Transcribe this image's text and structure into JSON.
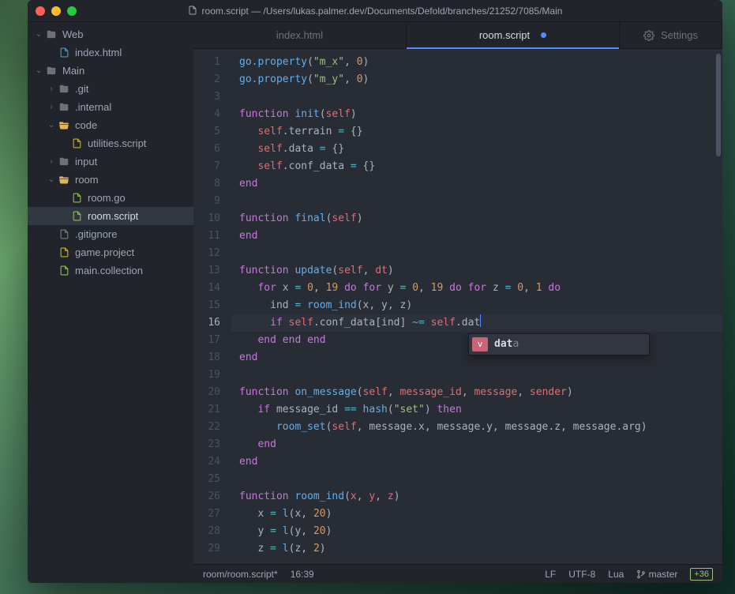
{
  "title": "room.script — /Users/lukas.palmer.dev/Documents/Defold/branches/21252/7085/Main",
  "sidebar": {
    "roots": [
      {
        "label": "Web",
        "expanded": true
      },
      {
        "label": "Main",
        "expanded": true
      }
    ],
    "web_children": [
      {
        "label": "index.html",
        "icon": "file-blue"
      }
    ],
    "main_children": [
      {
        "label": ".git",
        "icon": "folder-closed",
        "chev": "›"
      },
      {
        "label": ".internal",
        "icon": "folder-closed",
        "chev": "›"
      },
      {
        "label": "code",
        "icon": "folder-open",
        "chev": "⌄"
      },
      {
        "label": "utilities.script",
        "icon": "file-yellow",
        "indent": 1
      },
      {
        "label": "input",
        "icon": "folder-closed",
        "chev": "›"
      },
      {
        "label": "room",
        "icon": "folder-open",
        "chev": "⌄"
      },
      {
        "label": "room.go",
        "icon": "file-green",
        "indent": 1
      },
      {
        "label": "room.script",
        "icon": "file-green",
        "indent": 1,
        "active": true
      },
      {
        "label": ".gitignore",
        "icon": "file-grey"
      },
      {
        "label": "game.project",
        "icon": "file-yellow"
      },
      {
        "label": "main.collection",
        "icon": "file-green"
      }
    ]
  },
  "tabs": [
    {
      "label": "index.html",
      "active": false,
      "modified": false
    },
    {
      "label": "room.script",
      "active": true,
      "modified": true
    }
  ],
  "settings_label": "Settings",
  "code": {
    "lines": [
      [
        [
          "fn",
          "go.property"
        ],
        [
          "",
          "("
        ],
        [
          "str",
          "\"m_x\""
        ],
        [
          "",
          ", "
        ],
        [
          "num",
          "0"
        ],
        [
          "",
          ")"
        ]
      ],
      [
        [
          "fn",
          "go.property"
        ],
        [
          "",
          "("
        ],
        [
          "str",
          "\"m_y\""
        ],
        [
          "",
          ", "
        ],
        [
          "num",
          "0"
        ],
        [
          "",
          ")"
        ]
      ],
      [],
      [
        [
          "kw",
          "function"
        ],
        [
          "",
          " "
        ],
        [
          "fn",
          "init"
        ],
        [
          "",
          "("
        ],
        [
          "var",
          "self"
        ],
        [
          "",
          ")"
        ]
      ],
      [
        [
          "",
          "   "
        ],
        [
          "var",
          "self"
        ],
        [
          "",
          ".terrain "
        ],
        [
          "op",
          "="
        ],
        [
          "",
          " {}"
        ]
      ],
      [
        [
          "",
          "   "
        ],
        [
          "var",
          "self"
        ],
        [
          "",
          ".data "
        ],
        [
          "op",
          "="
        ],
        [
          "",
          " {}"
        ]
      ],
      [
        [
          "",
          "   "
        ],
        [
          "var",
          "self"
        ],
        [
          "",
          ".conf_data "
        ],
        [
          "op",
          "="
        ],
        [
          "",
          " {}"
        ]
      ],
      [
        [
          "kw",
          "end"
        ]
      ],
      [],
      [
        [
          "kw",
          "function"
        ],
        [
          "",
          " "
        ],
        [
          "fn",
          "final"
        ],
        [
          "",
          "("
        ],
        [
          "var",
          "self"
        ],
        [
          "",
          ")"
        ]
      ],
      [
        [
          "kw",
          "end"
        ]
      ],
      [],
      [
        [
          "kw",
          "function"
        ],
        [
          "",
          " "
        ],
        [
          "fn",
          "update"
        ],
        [
          "",
          "("
        ],
        [
          "var",
          "self"
        ],
        [
          "",
          ", "
        ],
        [
          "var",
          "dt"
        ],
        [
          "",
          ")"
        ]
      ],
      [
        [
          "",
          "   "
        ],
        [
          "kw",
          "for"
        ],
        [
          "",
          " x "
        ],
        [
          "op",
          "="
        ],
        [
          "",
          " "
        ],
        [
          "num",
          "0"
        ],
        [
          "",
          ", "
        ],
        [
          "num",
          "19"
        ],
        [
          "",
          " "
        ],
        [
          "kw",
          "do"
        ],
        [
          "",
          " "
        ],
        [
          "kw",
          "for"
        ],
        [
          "",
          " y "
        ],
        [
          "op",
          "="
        ],
        [
          "",
          " "
        ],
        [
          "num",
          "0"
        ],
        [
          "",
          ", "
        ],
        [
          "num",
          "19"
        ],
        [
          "",
          " "
        ],
        [
          "kw",
          "do"
        ],
        [
          "",
          " "
        ],
        [
          "kw",
          "for"
        ],
        [
          "",
          " z "
        ],
        [
          "op",
          "="
        ],
        [
          "",
          " "
        ],
        [
          "num",
          "0"
        ],
        [
          "",
          ", "
        ],
        [
          "num",
          "1"
        ],
        [
          "",
          " "
        ],
        [
          "kw",
          "do"
        ]
      ],
      [
        [
          "",
          "     ind "
        ],
        [
          "op",
          "="
        ],
        [
          "",
          " "
        ],
        [
          "fn",
          "room_ind"
        ],
        [
          "",
          "(x, y, z)"
        ]
      ],
      [
        [
          "",
          "     "
        ],
        [
          "kw",
          "if"
        ],
        [
          "",
          " "
        ],
        [
          "var",
          "self"
        ],
        [
          "",
          ".conf_data[ind] "
        ],
        [
          "op",
          "~="
        ],
        [
          "",
          " "
        ],
        [
          "var",
          "self"
        ],
        [
          "",
          ".dat"
        ]
      ],
      [
        [
          "",
          "   "
        ],
        [
          "kw",
          "end"
        ],
        [
          "",
          " "
        ],
        [
          "kw",
          "end"
        ],
        [
          "",
          " "
        ],
        [
          "kw",
          "end"
        ]
      ],
      [
        [
          "kw",
          "end"
        ]
      ],
      [],
      [
        [
          "kw",
          "function"
        ],
        [
          "",
          " "
        ],
        [
          "fn",
          "on_message"
        ],
        [
          "",
          "("
        ],
        [
          "var",
          "self"
        ],
        [
          "",
          ", "
        ],
        [
          "var",
          "message_id"
        ],
        [
          "",
          ", "
        ],
        [
          "var",
          "message"
        ],
        [
          "",
          ", "
        ],
        [
          "var",
          "sender"
        ],
        [
          "",
          ")"
        ]
      ],
      [
        [
          "",
          "   "
        ],
        [
          "kw",
          "if"
        ],
        [
          "",
          " message_id "
        ],
        [
          "op",
          "=="
        ],
        [
          "",
          " "
        ],
        [
          "fn",
          "hash"
        ],
        [
          "",
          "("
        ],
        [
          "str",
          "\"set\""
        ],
        [
          "",
          ") "
        ],
        [
          "kw",
          "then"
        ]
      ],
      [
        [
          "",
          "      "
        ],
        [
          "fn",
          "room_set"
        ],
        [
          "",
          "("
        ],
        [
          "var",
          "self"
        ],
        [
          "",
          ", message.x, message.y, message.z, message.arg)"
        ]
      ],
      [
        [
          "",
          "   "
        ],
        [
          "kw",
          "end"
        ]
      ],
      [
        [
          "kw",
          "end"
        ]
      ],
      [],
      [
        [
          "kw",
          "function"
        ],
        [
          "",
          " "
        ],
        [
          "fn",
          "room_ind"
        ],
        [
          "",
          "("
        ],
        [
          "var",
          "x"
        ],
        [
          "",
          ", "
        ],
        [
          "var",
          "y"
        ],
        [
          "",
          ", "
        ],
        [
          "var",
          "z"
        ],
        [
          "",
          ")"
        ]
      ],
      [
        [
          "",
          "   x "
        ],
        [
          "op",
          "="
        ],
        [
          "",
          " "
        ],
        [
          "fn",
          "l"
        ],
        [
          "",
          "(x, "
        ],
        [
          "num",
          "20"
        ],
        [
          "",
          ")"
        ]
      ],
      [
        [
          "",
          "   y "
        ],
        [
          "op",
          "="
        ],
        [
          "",
          " "
        ],
        [
          "fn",
          "l"
        ],
        [
          "",
          "(y, "
        ],
        [
          "num",
          "20"
        ],
        [
          "",
          ")"
        ]
      ],
      [
        [
          "",
          "   z "
        ],
        [
          "op",
          "="
        ],
        [
          "",
          " "
        ],
        [
          "fn",
          "l"
        ],
        [
          "",
          "(z, "
        ],
        [
          "num",
          "2"
        ],
        [
          "",
          ")"
        ]
      ]
    ],
    "current_line": 16,
    "autocomplete": {
      "badge": "v",
      "match": "dat",
      "rest": "a"
    }
  },
  "statusbar": {
    "file": "room/room.script*",
    "pos": "16:39",
    "line_ending": "LF",
    "encoding": "UTF-8",
    "language": "Lua",
    "branch": "master",
    "diff": "+36"
  }
}
